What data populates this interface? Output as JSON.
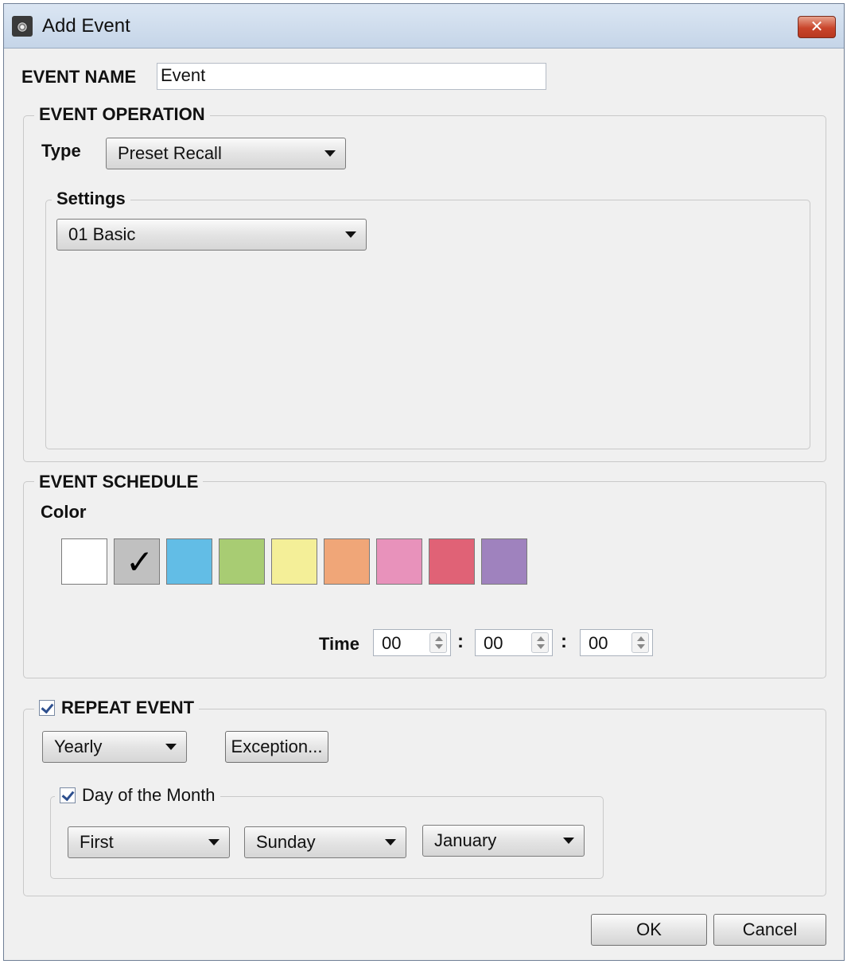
{
  "window": {
    "title": "Add Event",
    "close_symbol": "✕"
  },
  "event_name": {
    "label": "EVENT NAME",
    "value": "Event"
  },
  "event_operation": {
    "legend": "EVENT OPERATION",
    "type_label": "Type",
    "type_value": "Preset Recall",
    "settings_legend": "Settings",
    "settings_value": "01 Basic"
  },
  "event_schedule": {
    "legend": "EVENT SCHEDULE",
    "color_label": "Color",
    "colors": [
      "#ffffff",
      "#c0c0c0",
      "#62bde6",
      "#a8cc73",
      "#f4ef98",
      "#f0a678",
      "#e892bb",
      "#e06276",
      "#9f82be"
    ],
    "selected_color_index": 1,
    "check_mark": "✓",
    "time_label": "Time",
    "time": {
      "hours": "00",
      "minutes": "00",
      "seconds": "00"
    },
    "time_separator": ":"
  },
  "repeat_event": {
    "legend": "REPEAT EVENT",
    "checked": true,
    "frequency": "Yearly",
    "exception_button": "Exception...",
    "day_of_month": {
      "legend": "Day of the Month",
      "checked": true,
      "ordinal": "First",
      "weekday": "Sunday",
      "month": "January"
    }
  },
  "footer": {
    "ok_label": "OK",
    "cancel_label": "Cancel"
  }
}
